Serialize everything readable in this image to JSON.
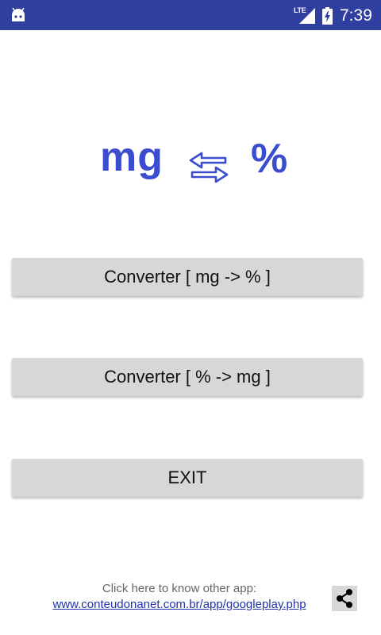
{
  "status_bar": {
    "network": "LTE",
    "time": "7:39",
    "icons": [
      "android-icon",
      "signal-icon",
      "battery-charging-icon"
    ]
  },
  "logo": {
    "left": "mg",
    "middle_icon": "swap-arrows-icon",
    "right": "%"
  },
  "buttons": {
    "mg_to_pct": "Converter [ mg -> % ]",
    "pct_to_mg": "Converter [ % -> mg ]",
    "exit": "EXIT"
  },
  "footer": {
    "caption": "Click here to know other app:",
    "link": "www.conteudonanet.com.br/app/googleplay.php",
    "share_icon": "share-icon"
  },
  "colors": {
    "status_bar": "#303f9f",
    "accent": "#3b4ccf",
    "button_bg": "#d6d7d7",
    "link": "#2233aa"
  }
}
